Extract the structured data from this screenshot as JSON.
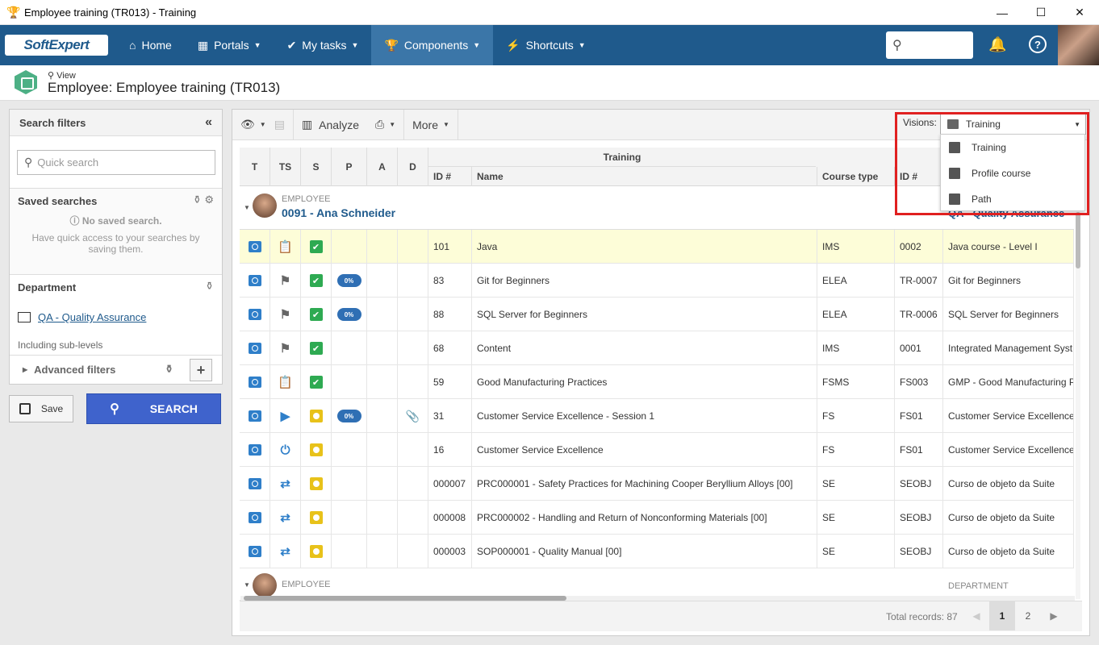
{
  "window": {
    "title": "Employee training (TR013) - Training",
    "minimize": "—",
    "maximize": "☐",
    "close": "✕"
  },
  "nav": {
    "logo": "SoftExpert",
    "items": [
      {
        "label": "Home",
        "icon": "home-icon"
      },
      {
        "label": "Portals",
        "icon": "grid-icon"
      },
      {
        "label": "My tasks",
        "icon": "check-icon"
      },
      {
        "label": "Components",
        "icon": "trophy-icon"
      },
      {
        "label": "Shortcuts",
        "icon": "bolt-icon"
      }
    ]
  },
  "header": {
    "view_label": "View",
    "title": "Employee: Employee training (TR013)"
  },
  "sidebar": {
    "title": "Search filters",
    "quick_search_placeholder": "Quick search",
    "saved_searches": {
      "title": "Saved searches",
      "empty_title": "No saved search.",
      "empty_text": "Have quick access to your searches by saving them."
    },
    "department": {
      "title": "Department",
      "value": "QA - Quality Assurance",
      "sublevels": "Including sub-levels"
    },
    "advanced_filters": "Advanced filters",
    "save_label": "Save",
    "search_label": "SEARCH"
  },
  "toolbar": {
    "analyze": "Analyze",
    "more": "More",
    "visions_label": "Visions:",
    "visions_value": "Training"
  },
  "visions_menu": [
    "Training",
    "Profile course",
    "Path"
  ],
  "grid": {
    "columns": [
      "T",
      "TS",
      "S",
      "P",
      "A",
      "D"
    ],
    "group": "Training",
    "subcolumns": [
      "ID #",
      "Name",
      "Course type",
      "ID #"
    ],
    "employee1": {
      "label": "EMPLOYEE",
      "name": "0091 - Ana Schneider",
      "department": "QA - Quality Assurance"
    },
    "employee2": {
      "label": "EMPLOYEE",
      "department_label": "DEPARTMENT"
    },
    "rows": [
      {
        "ts": "clipboard",
        "status": "ok",
        "p": "",
        "d": "",
        "id": "101",
        "name": "Java",
        "ctype": "IMS",
        "cid": "0002",
        "cname": "Java course - Level I"
      },
      {
        "ts": "flag",
        "status": "ok",
        "p": "0%",
        "d": "",
        "id": "83",
        "name": "Git for Beginners",
        "ctype": "ELEA",
        "cid": "TR-0007",
        "cname": "Git for Beginners"
      },
      {
        "ts": "flag",
        "status": "ok",
        "p": "0%",
        "d": "",
        "id": "88",
        "name": "SQL Server for Beginners",
        "ctype": "ELEA",
        "cid": "TR-0006",
        "cname": "SQL Server for Beginners"
      },
      {
        "ts": "flag",
        "status": "ok",
        "p": "",
        "d": "",
        "id": "68",
        "name": "Content",
        "ctype": "IMS",
        "cid": "0001",
        "cname": "Integrated Management Syst"
      },
      {
        "ts": "clipboard",
        "status": "ok",
        "p": "",
        "d": "",
        "id": "59",
        "name": "Good Manufacturing Practices",
        "ctype": "FSMS",
        "cid": "FS003",
        "cname": "GMP - Good Manufacturing P"
      },
      {
        "ts": "play",
        "status": "pending",
        "p": "0%",
        "d": "clip",
        "id": "31",
        "name": "Customer Service Excellence - Session 1",
        "ctype": "FS",
        "cid": "FS01",
        "cname": "Customer Service Excellence"
      },
      {
        "ts": "power",
        "status": "pending",
        "p": "",
        "d": "",
        "id": "16",
        "name": "Customer Service Excellence",
        "ctype": "FS",
        "cid": "FS01",
        "cname": "Customer Service Excellence"
      },
      {
        "ts": "shuffle",
        "status": "pending",
        "p": "",
        "d": "",
        "id": "000007",
        "name": "PRC000001 - Safety Practices for Machining Cooper Beryllium Alloys [00]",
        "ctype": "SE",
        "cid": "SEOBJ",
        "cname": "Curso de objeto da Suite"
      },
      {
        "ts": "shuffle",
        "status": "pending",
        "p": "",
        "d": "",
        "id": "000008",
        "name": "PRC000002 - Handling and Return of Nonconforming Materials [00]",
        "ctype": "SE",
        "cid": "SEOBJ",
        "cname": "Curso de objeto da Suite"
      },
      {
        "ts": "shuffle",
        "status": "pending",
        "p": "",
        "d": "",
        "id": "000003",
        "name": "SOP000001 - Quality Manual [00]",
        "ctype": "SE",
        "cid": "SEOBJ",
        "cname": "Curso de objeto da Suite"
      }
    ]
  },
  "footer": {
    "total": "Total records: 87",
    "pages": [
      "1",
      "2"
    ]
  },
  "colors": {
    "nav": "#1f5a8c",
    "active_nav": "#3b76a8",
    "search_button": "#3f63cc",
    "highlight_row": "#fdfdd8",
    "highlight_box": "#e02020"
  }
}
